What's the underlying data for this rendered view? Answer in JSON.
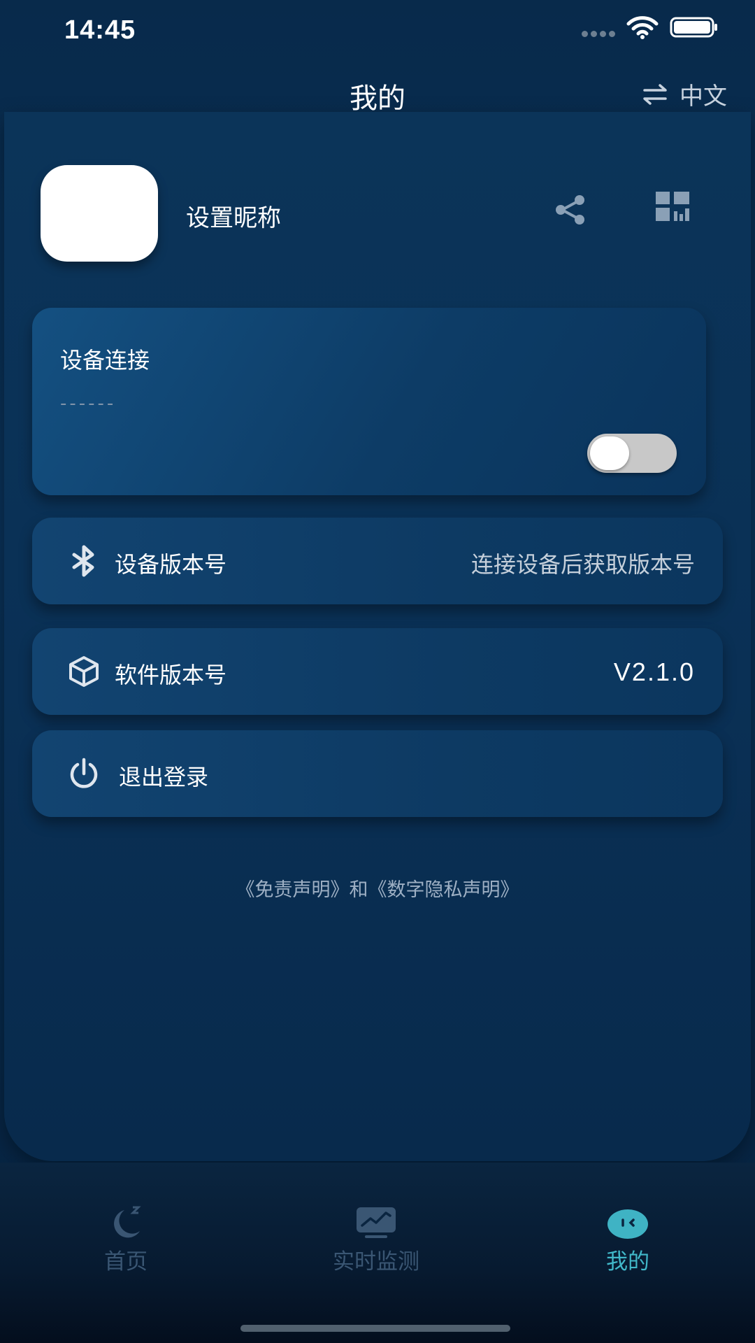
{
  "status_bar": {
    "time": "14:45",
    "wifi_icon": "wifi-icon",
    "battery_icon": "battery-icon"
  },
  "header": {
    "title": "我的",
    "language_label": "中文",
    "language_icon": "swap-icon"
  },
  "profile": {
    "nickname": "设置昵称",
    "share_icon": "share-icon",
    "qr_icon": "grid-icon"
  },
  "device_connection": {
    "title": "设备连接",
    "status": "------",
    "toggle_on": false
  },
  "rows": {
    "device_version": {
      "label": "设备版本号",
      "value": "连接设备后获取版本号",
      "icon": "bluetooth-icon"
    },
    "software_version": {
      "label": "软件版本号",
      "value": "V2.1.0",
      "icon": "cube-icon"
    },
    "logout": {
      "label": "退出登录",
      "icon": "power-icon"
    }
  },
  "legal_text": "《免责声明》和《数字隐私声明》",
  "tabs": [
    {
      "label": "首页",
      "icon": "moon-icon",
      "active": false
    },
    {
      "label": "实时监测",
      "icon": "monitor-chart-icon",
      "active": false
    },
    {
      "label": "我的",
      "icon": "face-icon",
      "active": true
    }
  ],
  "colors": {
    "background": "#0a2b4d",
    "card": "#0d3c66",
    "active_tab": "#41b8c9",
    "inactive_tab": "#3a5673"
  }
}
